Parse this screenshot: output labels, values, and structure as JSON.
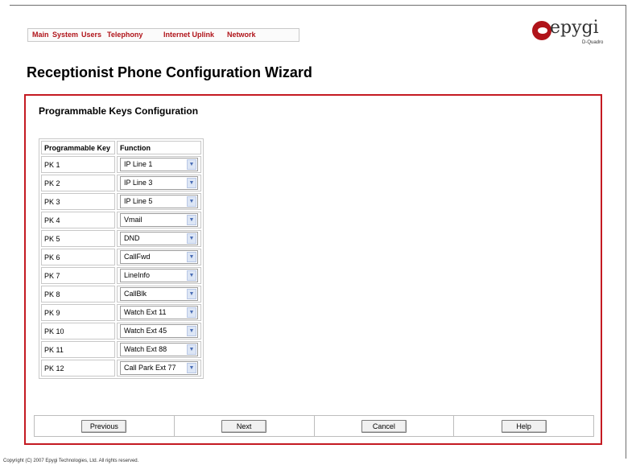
{
  "nav": {
    "items": [
      "Main",
      "System",
      "Users",
      "Telephony",
      "Internet Uplink",
      "Network"
    ]
  },
  "logo": {
    "text": "epygi",
    "sub": "D-Quadro",
    "icon": "epygi-logo-icon"
  },
  "page_title": "Receptionist Phone Configuration Wizard",
  "section_title": "Programmable Keys Configuration",
  "table": {
    "headers": [
      "Programmable Key",
      "Function"
    ],
    "rows": [
      {
        "key": "PK 1",
        "function": "IP Line 1"
      },
      {
        "key": "PK 2",
        "function": "IP Line 3"
      },
      {
        "key": "PK 3",
        "function": "IP Line 5"
      },
      {
        "key": "PK 4",
        "function": "Vmail"
      },
      {
        "key": "PK 5",
        "function": "DND"
      },
      {
        "key": "PK 6",
        "function": "CallFwd"
      },
      {
        "key": "PK 7",
        "function": "LineInfo"
      },
      {
        "key": "PK 8",
        "function": "CallBlk"
      },
      {
        "key": "PK 9",
        "function": "Watch Ext 11"
      },
      {
        "key": "PK 10",
        "function": "Watch Ext 45"
      },
      {
        "key": "PK 11",
        "function": "Watch Ext 88"
      },
      {
        "key": "PK 12",
        "function": "Call Park Ext 77"
      }
    ]
  },
  "buttons": {
    "previous": "Previous",
    "next": "Next",
    "cancel": "Cancel",
    "help": "Help"
  },
  "footer": "Copyright (C) 2007 Epygi Technologies, Ltd. All rights reserved.",
  "colors": {
    "brand_red": "#b0141a",
    "panel_border": "#c41a22"
  }
}
